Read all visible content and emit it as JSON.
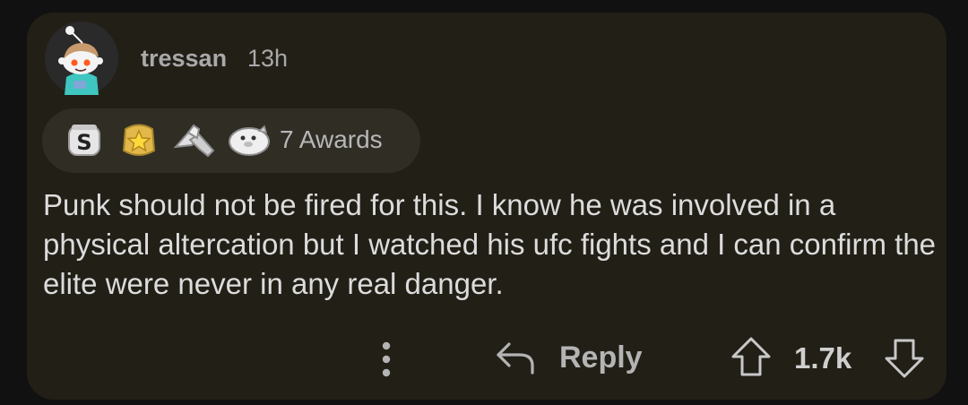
{
  "comment": {
    "author": "tressan",
    "age": "13h",
    "avatar_icon": "reddit-snoo-avatar-icon",
    "awards": {
      "icons": [
        "silver-award-icon",
        "helpful-star-award-icon",
        "handshake-award-icon",
        "seal-award-icon"
      ],
      "label": "7 Awards"
    },
    "body": "Punk should not be fired for this. I know he was involved in a physical altercation but I watched his ufc fights and I can confirm the elite were never in any real danger."
  },
  "actions": {
    "more_icon": "more-vertical-icon",
    "reply_label": "Reply",
    "upvote_icon": "upvote-arrow-icon",
    "score": "1.7k",
    "downvote_icon": "downvote-arrow-icon"
  },
  "colors": {
    "page_background": "#111111",
    "card_background": "#221f17",
    "awards_pill": "#302d25",
    "text_primary": "#dcdcdc",
    "text_muted": "#a9a9a9"
  }
}
